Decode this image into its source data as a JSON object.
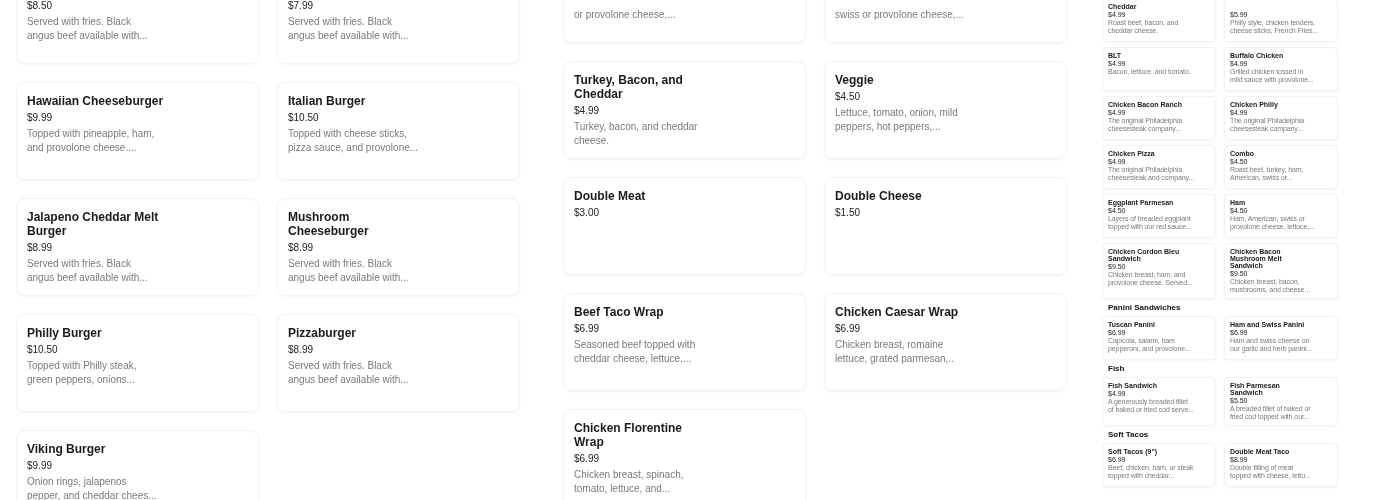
{
  "panels": [
    {
      "sections": [
        {
          "items": [
            {
              "price": "$8.50",
              "description": "Served with fries. Black\nangus beef available with..."
            },
            {
              "price": "$7.99",
              "description": "Served with fries. Black\nangus beef available with..."
            },
            {
              "name": "Hawaiian Cheeseburger",
              "price": "$9.99",
              "description": "Topped with pineapple, ham,\nand provolone cheese...."
            },
            {
              "name": "Italian Burger",
              "price": "$10.50",
              "description": "Topped with cheese sticks,\npizza sauce, and provolone..."
            },
            {
              "name": "Jalapeno Cheddar Melt\nBurger",
              "price": "$8.99",
              "description": "Served with fries. Black\nangus beef available with..."
            },
            {
              "name": "Mushroom\nCheeseburger",
              "price": "$8.99",
              "description": "Served with fries. Black\nangus beef available with..."
            },
            {
              "name": "Philly Burger",
              "price": "$10.50",
              "description": "Topped with Philly steak,\ngreen peppers, onions..."
            },
            {
              "name": "Pizzaburger",
              "price": "$8.99",
              "description": "Served with fries. Black\nangus beef available with..."
            },
            {
              "name": "Viking Burger",
              "price": "$9.99",
              "description": "Onion rings, jalapenos\npepper, and cheddar chees..."
            }
          ]
        }
      ]
    },
    {
      "sections": [
        {
          "items": [
            {
              "description": "or provolone cheese,..."
            },
            {
              "description": "swiss or provolone cheese,..."
            },
            {
              "name": "Turkey, Bacon, and\nCheddar",
              "price": "$4.99",
              "description": "Turkey, bacon, and cheddar\ncheese."
            },
            {
              "name": "Veggie",
              "price": "$4.50",
              "description": "Lettuce, tomato, onion, mild\npeppers, hot peppers,..."
            },
            {
              "name": "Double Meat",
              "price": "$3.00"
            },
            {
              "name": "Double Cheese",
              "price": "$1.50"
            },
            {
              "name": "Beef Taco Wrap",
              "price": "$6.99",
              "description": "Seasoned beef topped with\ncheddar cheese, lettuce,..."
            },
            {
              "name": "Chicken Caesar Wrap",
              "price": "$6.99",
              "description": "Chicken breast, romaine\nlettuce, grated parmesan,.."
            },
            {
              "name": "Chicken Florentine\nWrap",
              "price": "$6.99",
              "description": "Chicken breast, spinach,\ntomato, lettuce, and..."
            }
          ]
        }
      ]
    },
    {
      "sections": [
        {
          "items": [
            {
              "name": "Cheddar",
              "price": "$4.99",
              "description": "Roast beef, bacon, and\ncheddar cheese."
            },
            {
              "price": "$5.99",
              "description": "Philly style, chicken tenders,\ncheese sticks, French Fries..."
            },
            {
              "name": "BLT",
              "price": "$4.99",
              "description": "Bacon, lettuce, and tomato."
            },
            {
              "name": "Buffalo Chicken",
              "price": "$4.99",
              "description": "Grilled chicken tossed in\nmild sauce with provolone..."
            },
            {
              "name": "Chicken Bacon Ranch",
              "price": "$4.99",
              "description": "The original Philadelphia\ncheesesteak company..."
            },
            {
              "name": "Chicken Philly",
              "price": "$4.99",
              "description": "The original Philadelphia\ncheesesteak company..."
            },
            {
              "name": "Chicken Pizza",
              "price": "$4.99",
              "description": "The original Philadelphia\ncheesesteak and company..."
            },
            {
              "name": "Combo",
              "price": "$4.50",
              "description": "Roast beef, turkey, ham,\nAmerican, swiss or..."
            },
            {
              "name": "Eggplant Parmesan",
              "price": "$4.50",
              "description": "Layers of breaded eggplant\ntopped with our red sauce..."
            },
            {
              "name": "Ham",
              "price": "$4.50",
              "description": "Ham, American, swiss or\nprovolone cheese, lettuce,..."
            },
            {
              "name": "Chicken Cordon Bleu\nSandwich",
              "price": "$9.50",
              "description": "Chicken breast, ham, and\nprovolone cheese. Served..."
            },
            {
              "name": "Chicken Bacon\nMushroom Melt\nSandwich",
              "price": "$9.50",
              "description": "Chicken breast, bacon,\nmushrooms, and cheese..."
            }
          ]
        },
        {
          "heading": "Panini Sandwiches",
          "items": [
            {
              "name": "Tuscan Panini",
              "price": "$6.99",
              "description": "Capicola, salami, ham\npepperoni, and provolone..."
            },
            {
              "name": "Ham and Swiss Panini",
              "price": "$6.99",
              "description": "Ham and swiss cheese on\nour garlic and herb panini..."
            }
          ]
        },
        {
          "heading": "Fish",
          "items": [
            {
              "name": "Fish Sandwich",
              "price": "$4.99",
              "description": "A generously breaded fillet\nof baked or fried cod serve..."
            },
            {
              "name": "Fish Parmesan\nSandwich",
              "price": "$5.50",
              "description": "A breaded fillet of baked or\nfried cod topped with our..."
            }
          ]
        },
        {
          "heading": "Soft Tacos",
          "items": [
            {
              "name": "Soft Tacos (9\")",
              "price": "$6.99",
              "description": "Beef, chicken, ham, or steak\ntopped with cheddar..."
            },
            {
              "name": "Double Meat Taco",
              "price": "$8.99",
              "description": "Double filling of meat\ntopped with cheese, lettu..."
            }
          ]
        }
      ]
    }
  ]
}
